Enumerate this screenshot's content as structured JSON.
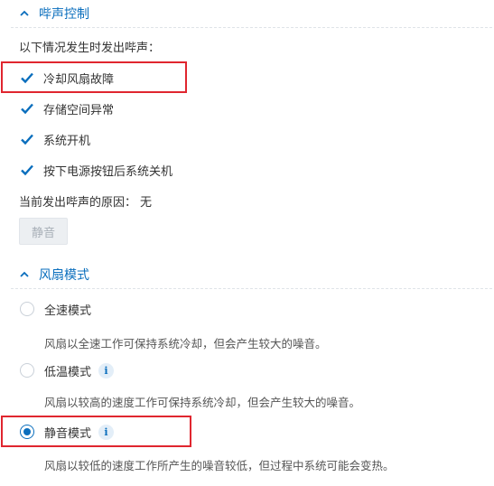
{
  "beep": {
    "title": "哔声控制",
    "intro": "以下情况发生时发出哔声：",
    "options": [
      {
        "label": "冷却风扇故障",
        "checked": true
      },
      {
        "label": "存储空间异常",
        "checked": true
      },
      {
        "label": "系统开机",
        "checked": true
      },
      {
        "label": "按下电源按钮后系统关机",
        "checked": true
      }
    ],
    "reason_label": "当前发出哔声的原因：",
    "reason_value": "无",
    "mute_button": "静音"
  },
  "fan": {
    "title": "风扇模式",
    "modes": [
      {
        "label": "全速模式",
        "desc": "风扇以全速工作可保持系统冷却，但会产生较大的噪音。",
        "selected": false,
        "info": false
      },
      {
        "label": "低温模式",
        "desc": "风扇以较高的速度工作可保持系统冷却，但会产生较大的噪音。",
        "selected": false,
        "info": true
      },
      {
        "label": "静音模式",
        "desc": "风扇以较低的速度工作所产生的噪音较低，但过程中系统可能会变热。",
        "selected": true,
        "info": true
      }
    ],
    "info_glyph": "i"
  },
  "colors": {
    "accent": "#0a6ebd",
    "highlight": "#e0262f"
  }
}
